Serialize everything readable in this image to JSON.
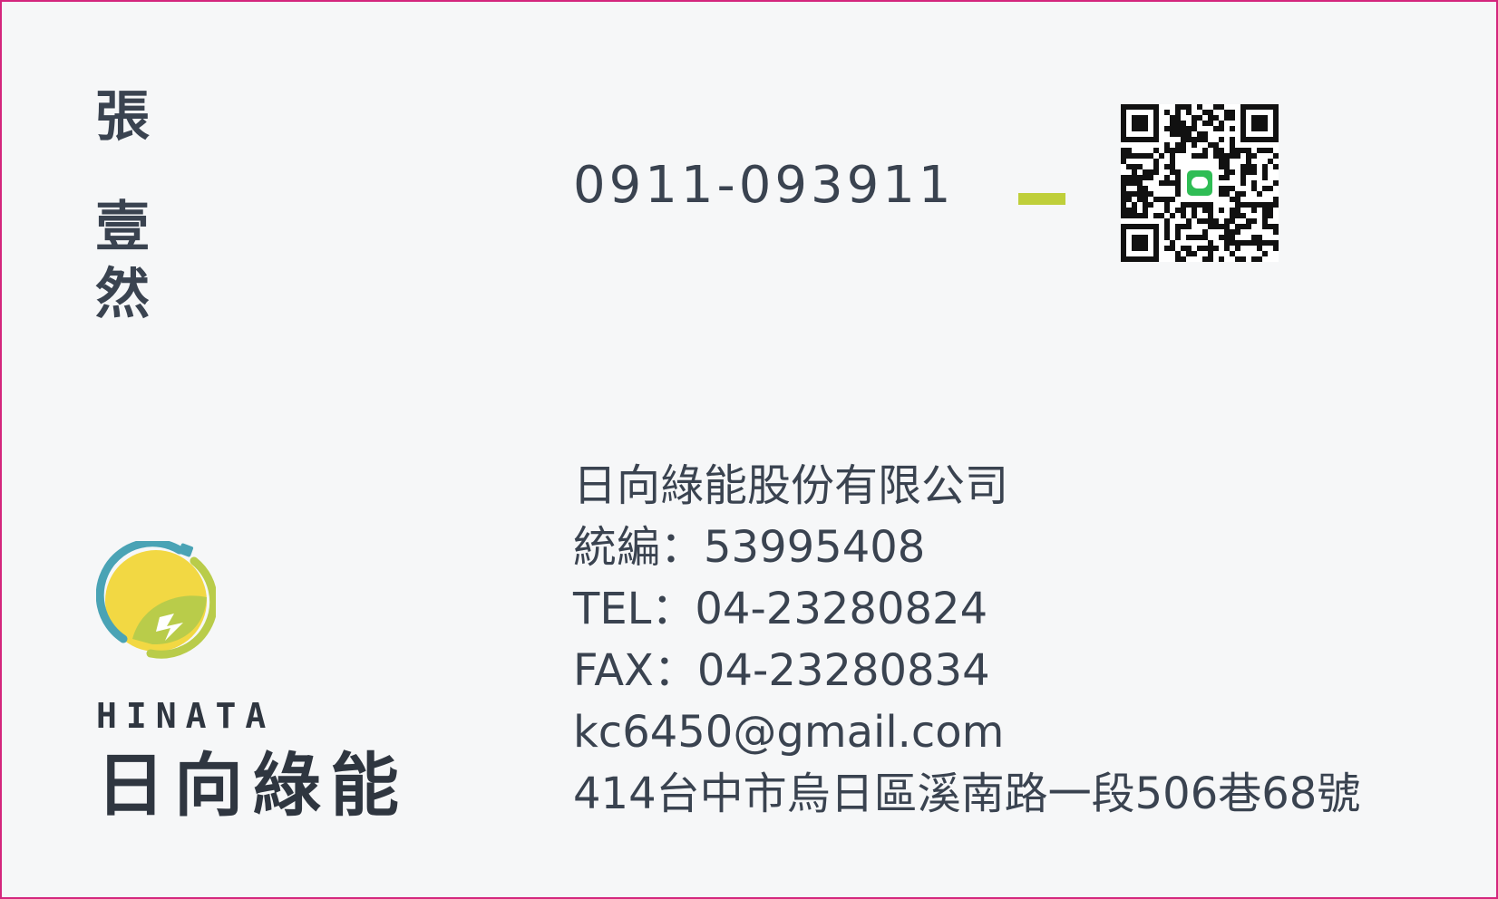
{
  "person": {
    "name_chars": [
      "張",
      "壹",
      "然"
    ]
  },
  "contact": {
    "mobile": "0911-093911"
  },
  "qr": {
    "icon": "line-qr-code-icon",
    "badge_text": "LINE"
  },
  "company": {
    "name": "日向綠能股份有限公司",
    "tax_id": "統編：53995408",
    "tel": "TEL：04-23280824",
    "fax": "FAX：04-23280834",
    "email": "kc6450@gmail.com",
    "address": "414台中市烏日區溪南路一段506巷68號"
  },
  "brand": {
    "logo_icon": "sun-leaf-plug-icon",
    "name_en": "HINATA",
    "name_zh": "日向綠能",
    "watermark": "HINATA"
  },
  "colors": {
    "border": "#d4267d",
    "text": "#3a4350",
    "accent_green": "#bfcf3a",
    "logo_blue": "#4aa3b5",
    "logo_yellow": "#f2d843",
    "logo_green": "#b9cc4a"
  }
}
